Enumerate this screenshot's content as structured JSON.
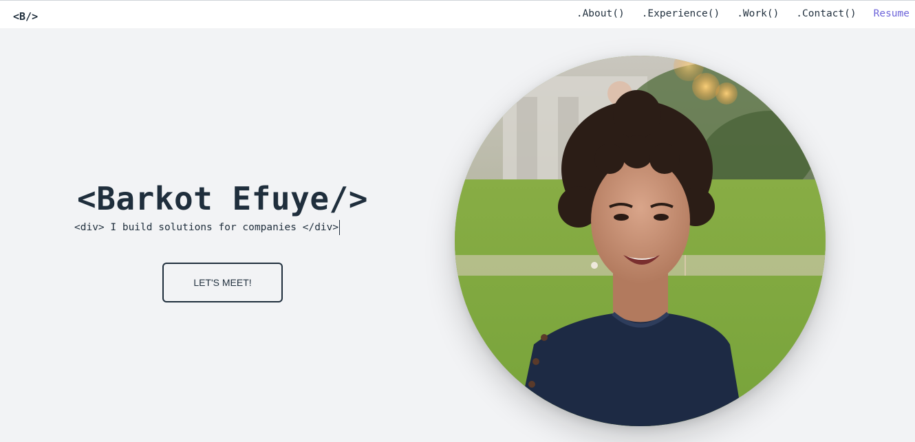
{
  "nav": {
    "logo": "<B/>",
    "links": [
      ".About()",
      ".Experience()",
      ".Work()",
      ".Contact()"
    ],
    "resume": "Resume",
    "resume_color": "#6c63d9"
  },
  "hero": {
    "name": "<Barkot Efuye/>",
    "subtitle": "<div> I build solutions for companies </div>",
    "cta": "LET'S MEET!"
  },
  "colors": {
    "text": "#1f2e3c",
    "background": "#f2f3f5"
  }
}
